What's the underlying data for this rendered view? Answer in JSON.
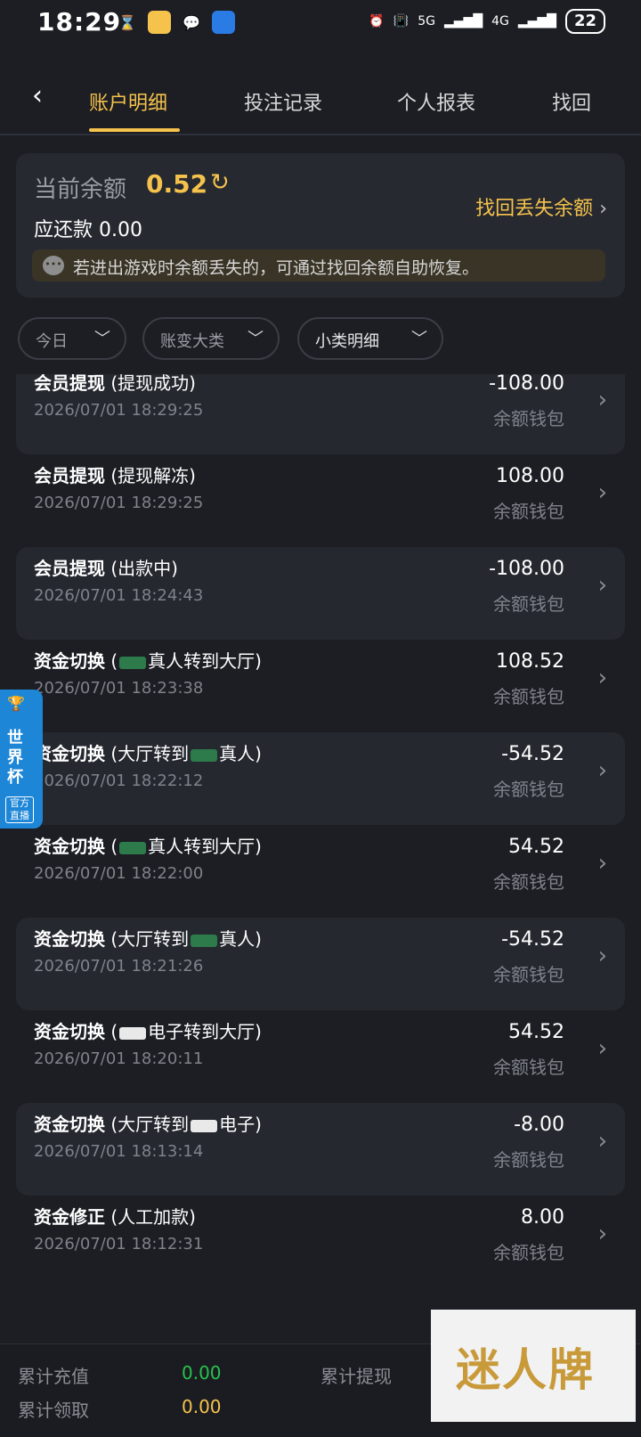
{
  "status": {
    "time": "18:29",
    "network1": "5G",
    "network2": "4G",
    "battery": "22"
  },
  "tabs": [
    {
      "label": "账户明细"
    },
    {
      "label": "投注记录"
    },
    {
      "label": "个人报表"
    },
    {
      "label": "找回"
    }
  ],
  "balance": {
    "label": "当前余额",
    "value": "0.52",
    "due_label": "应还款",
    "due_value": "0.00",
    "recover_label": "找回丢失余额",
    "notice": "若进出游戏时余额丢失的，可通过找回余额自助恢复。"
  },
  "filters": [
    "今日",
    "账变大类",
    "小类明细"
  ],
  "rows": [
    {
      "title": "会员提现",
      "sub": "(提现成功)",
      "time": "2026/07/01 18:29:25",
      "amount": "-108.00",
      "wallet": "余额钱包"
    },
    {
      "title": "会员提现",
      "sub": "(提现解冻)",
      "time": "2026/07/01 18:29:25",
      "amount": "108.00",
      "wallet": "余额钱包"
    },
    {
      "title": "会员提现",
      "sub": "(出款中)",
      "time": "2026/07/01 18:24:43",
      "amount": "-108.00",
      "wallet": "余额钱包"
    },
    {
      "title": "资金切换",
      "sub_pre": "(",
      "sub_post": "真人转到大厅)",
      "time": "2026/07/01 18:23:38",
      "amount": "108.52",
      "wallet": "余额钱包"
    },
    {
      "title": "资金切换",
      "sub_pre": "(大厅转到",
      "sub_post": "真人)",
      "time": "2026/07/01 18:22:12",
      "amount": "-54.52",
      "wallet": "余额钱包"
    },
    {
      "title": "资金切换",
      "sub_pre": "(",
      "sub_post": "真人转到大厅)",
      "time": "2026/07/01 18:22:00",
      "amount": "54.52",
      "wallet": "余额钱包"
    },
    {
      "title": "资金切换",
      "sub_pre": "(大厅转到",
      "sub_post": "真人)",
      "time": "2026/07/01 18:21:26",
      "amount": "-54.52",
      "wallet": "余额钱包"
    },
    {
      "title": "资金切换",
      "sub_pre": "(",
      "sub_post": "电子转到大厅)",
      "time": "2026/07/01 18:20:11",
      "amount": "54.52",
      "wallet": "余额钱包"
    },
    {
      "title": "资金切换",
      "sub_pre": "(大厅转到",
      "sub_post": "电子)",
      "time": "2026/07/01 18:13:14",
      "amount": "-8.00",
      "wallet": "余额钱包"
    },
    {
      "title": "资金修正",
      "sub": "(人工加款)",
      "time": "2026/07/01 18:12:31",
      "amount": "8.00",
      "wallet": "余额钱包"
    }
  ],
  "badge": {
    "title": "世界杯",
    "tag": "官方直播"
  },
  "footer": {
    "deposit_label": "累计充值",
    "deposit_value": "0.00",
    "withdraw_label": "累计提现",
    "claim_label": "累计领取",
    "claim_value": "0.00"
  },
  "watermark": "迷人牌",
  "colors": {
    "accent": "#f5c24c",
    "bg": "#1c1e24",
    "green": "#27c24c"
  }
}
